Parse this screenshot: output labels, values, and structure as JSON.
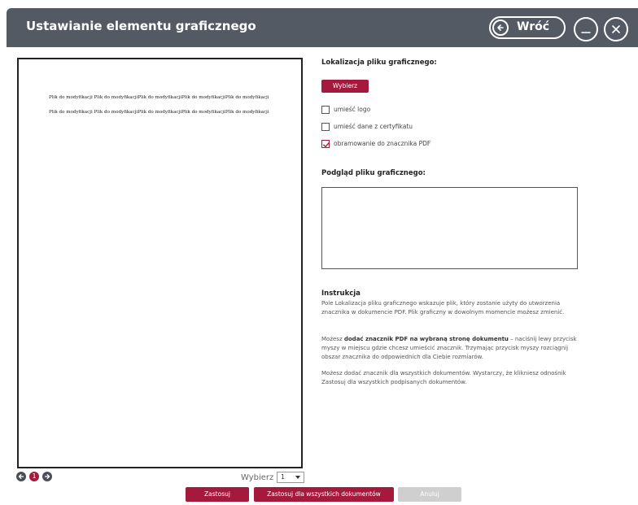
{
  "window": {
    "title": "Ustawianie elementu graficznego",
    "back_label": "Wróć"
  },
  "document": {
    "lines": [
      "Plik do modyfikacji Plik do modyfikacjiPlik do modyfikacjiPlik do modyfikacjiPlik do modyfikacji",
      "Plik do modyfikacji Plik do modyfikacjiPlik do modyfikacjiPlik do modyfikacjiPlik do modyfikacji"
    ]
  },
  "pager": {
    "current_page": "1",
    "select_label": "Wybierz",
    "select_value": "1"
  },
  "settings": {
    "location_label": "Lokalizacja pliku graficznego:",
    "choose_button": "Wybierz",
    "checkboxes": [
      {
        "label": "umieść logo",
        "checked": false
      },
      {
        "label": "umieść dane z certyfikatu",
        "checked": false
      },
      {
        "label": "obramowanie do znacznika PDF",
        "checked": true
      }
    ],
    "preview_label": "Podgląd pliku graficznego:"
  },
  "instructions": {
    "title": "Instrukcja",
    "p1": "Pole Lokalizacja pliku graficznego wskazuje plik, który zostanie użyty do utworzenia znacznika w dokumencie PDF. Plik graficzny w dowolnym momencie możesz zmienić.",
    "p2_prefix": "Możesz ",
    "p2_bold": "dodać znacznik PDF na wybraną stronę dokumentu",
    "p2_suffix": " – naciśnij lewy przycisk myszy w miejscu gdzie chcesz umieścić znacznik. Trzymając przycisk myszy rozciągnij obszar znacznika do odpowiednich dla Ciebie rozmiarów.",
    "p3": "Możesz dodać znacznik dla wszystkich dokumentów. Wystarczy, że klikniesz odnośnik Zastosuj dla wszystkich podpisanych dokumentów."
  },
  "actions": {
    "apply": "Zastosuj",
    "apply_all": "Zastosuj dla wszystkich dokumentów",
    "cancel": "Anuluj"
  },
  "colors": {
    "accent": "#a5193c",
    "titlebar": "#545a64",
    "disabled": "#cfcfcf"
  }
}
